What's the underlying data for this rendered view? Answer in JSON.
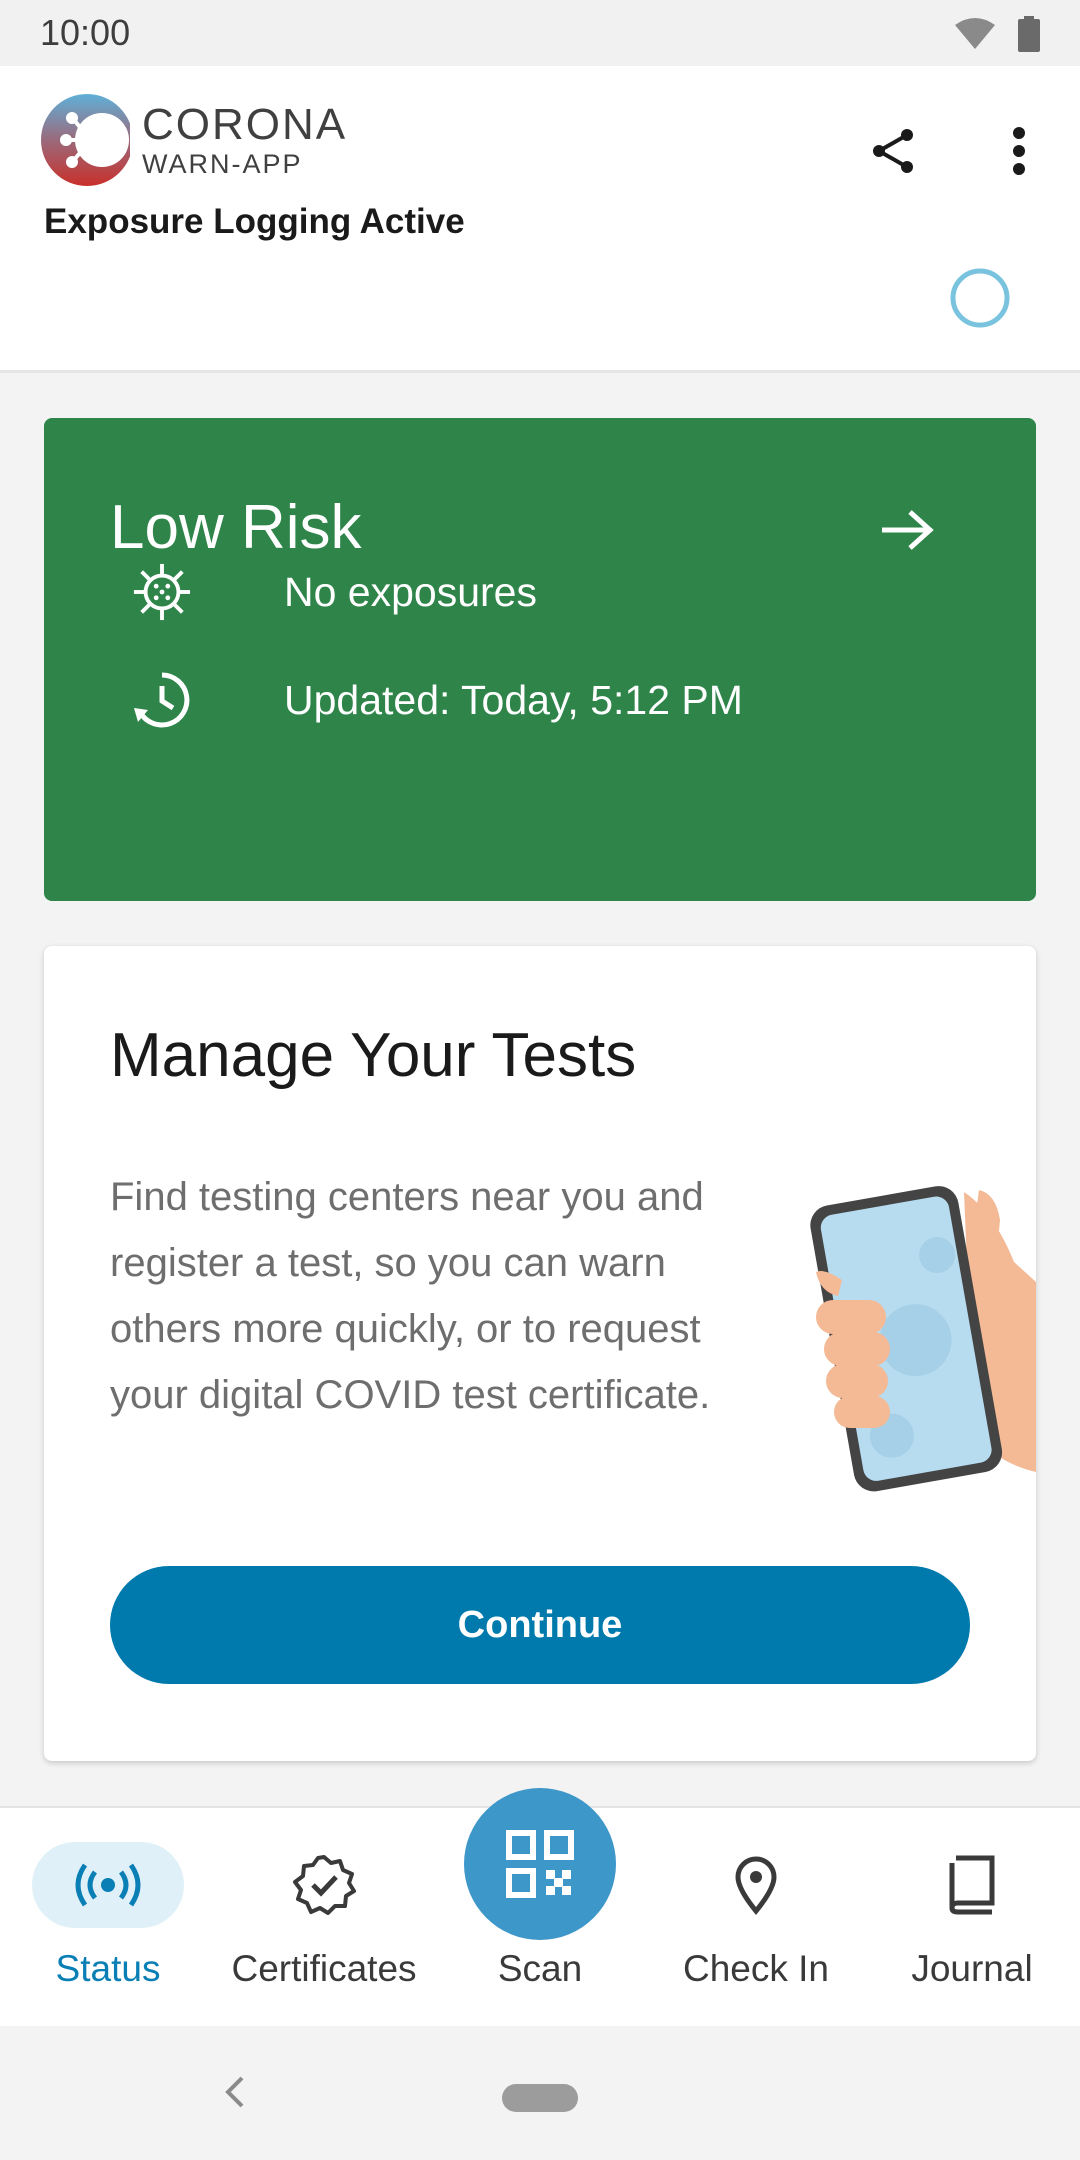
{
  "status_bar": {
    "time": "10:00",
    "icons": [
      "wifi-icon",
      "battery-icon"
    ]
  },
  "header": {
    "logo_title": "CORONA",
    "logo_subtitle": "WARN-APP",
    "actions": [
      "share-icon",
      "more-vert-icon"
    ]
  },
  "exposure": {
    "label": "Exposure Logging Active"
  },
  "risk_card": {
    "title": "Low Risk",
    "color": "#2e8449",
    "rows": [
      {
        "icon": "virus-icon",
        "text": "No exposures"
      },
      {
        "icon": "clock-update-icon",
        "text": "Updated: Today, 5:12 PM"
      }
    ]
  },
  "tests_card": {
    "title": "Manage Your Tests",
    "body": "Find testing centers near you and register a test, so you can warn others more quickly, or to request your digital COVID test certificate.",
    "button": "Continue",
    "button_color": "#0079ac"
  },
  "bottom_nav": {
    "items": [
      {
        "label": "Status",
        "icon": "broadcast-icon",
        "active": true
      },
      {
        "label": "Certificates",
        "icon": "certificate-badge-icon",
        "active": false
      },
      {
        "label": "Scan",
        "icon": "qr-code-icon",
        "active": false
      },
      {
        "label": "Check In",
        "icon": "location-pin-icon",
        "active": false
      },
      {
        "label": "Journal",
        "icon": "book-icon",
        "active": false
      }
    ],
    "accent": "#0a7fb5"
  }
}
